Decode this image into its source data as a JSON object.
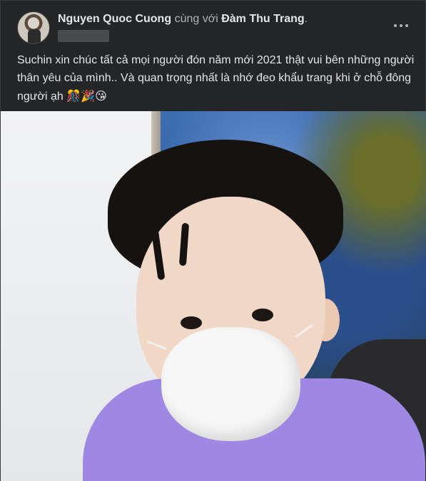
{
  "post": {
    "author": "Nguyen Quoc Cuong",
    "with_word": "cùng với",
    "tagged": "Đàm Thu Trang",
    "period": ".",
    "caption_text": "Suchin xin chúc tất cả mọi người đón năm mới  2021 thật vui bên những người thân yêu của mình.. Và quan trọng nhất là nhớ đeo khẩu trang khi ở chỗ đông người ạh ",
    "caption_emojis": "🎊🎉😘"
  },
  "icons": {
    "more": "more-horizontal-icon"
  },
  "colors": {
    "background": "#242526",
    "primary_text": "#e4e6eb",
    "secondary_text": "#b0b3b8"
  }
}
